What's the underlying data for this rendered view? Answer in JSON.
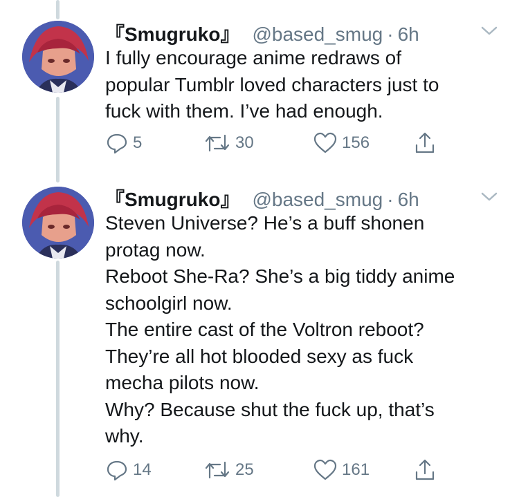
{
  "tweets": [
    {
      "display_name": "『Smugruko』",
      "handle": "@based_smug",
      "separator": "·",
      "time": "6h",
      "lines": [
        "I fully encourage anime redraws of",
        "popular Tumblr loved characters just to",
        "fuck with them. I’ve had enough."
      ],
      "replies": "5",
      "retweets": "30",
      "likes": "156"
    },
    {
      "display_name": "『Smugruko』",
      "handle": "@based_smug",
      "separator": "·",
      "time": "6h",
      "lines": [
        "Steven Universe? He’s a buff shonen",
        "protag now.",
        "Reboot She-Ra? She’s a big tiddy anime",
        "schoolgirl now.",
        "The entire cast of the Voltron reboot?",
        "They’re all hot blooded sexy as fuck",
        "mecha pilots now.",
        "Why? Because shut the fuck up, that’s",
        "why."
      ],
      "replies": "14",
      "retweets": "25",
      "likes": "161"
    }
  ],
  "icons": {
    "reply": "reply-icon",
    "retweet": "retweet-icon",
    "like": "heart-icon",
    "share": "share-icon",
    "caret": "chevron-down-icon"
  },
  "colors": {
    "text": "#14171a",
    "secondary": "#657786",
    "thread_line": "#cfd9de"
  }
}
